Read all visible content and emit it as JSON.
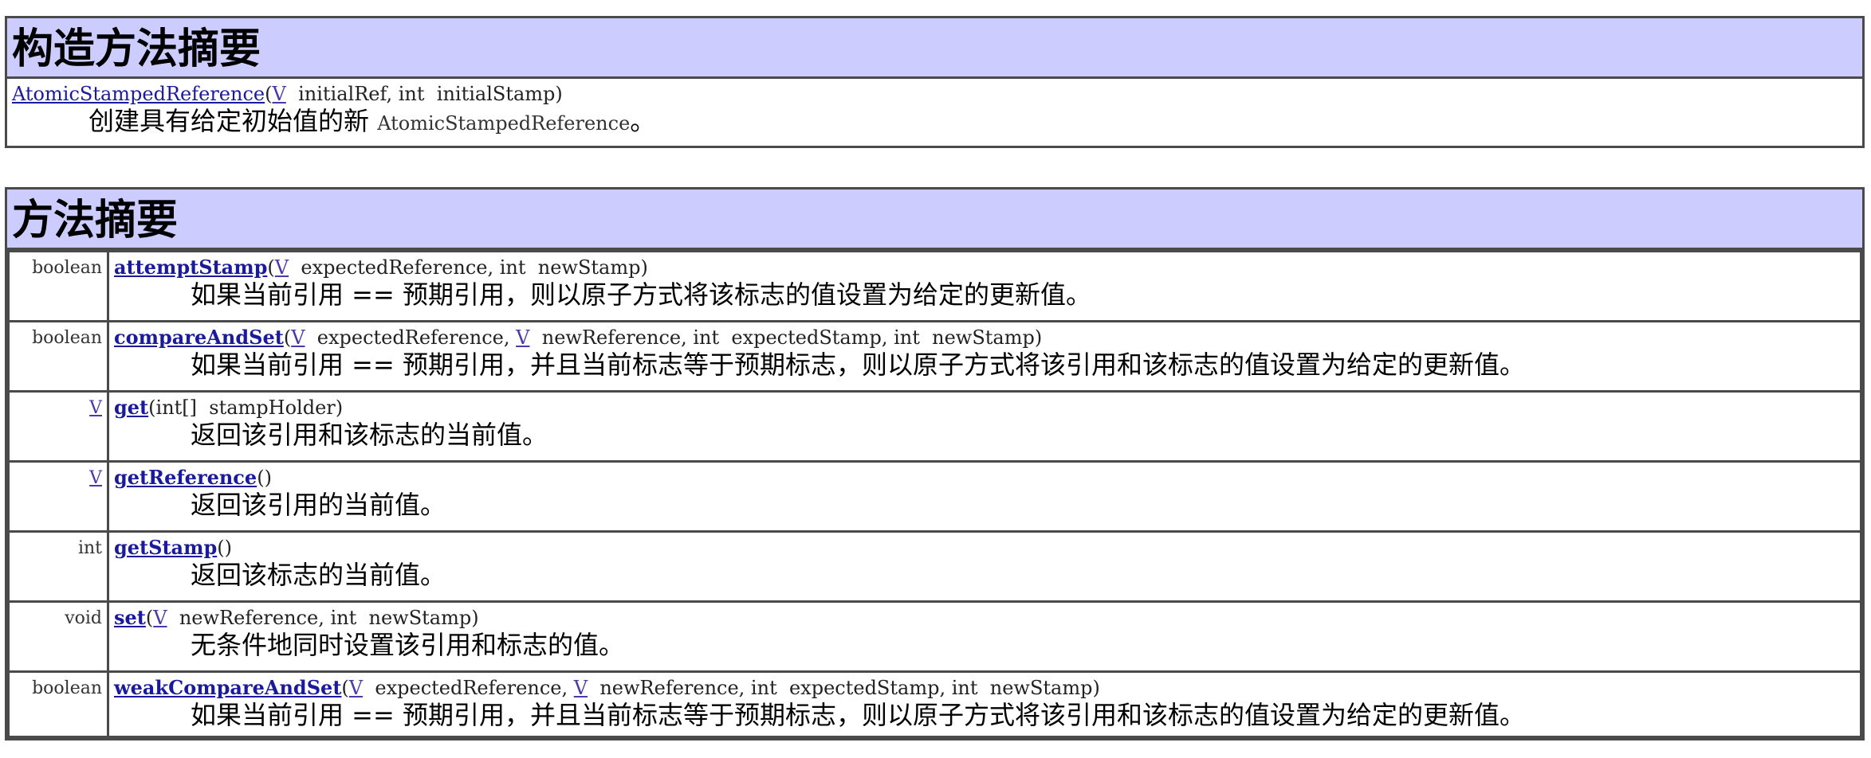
{
  "constructor_summary": {
    "title": "构造方法摘要",
    "rows": [
      {
        "name": "AtomicStampedReference",
        "sig_open": "(",
        "type1": "V",
        "p1": "  initialRef, int  initialStamp)",
        "desc_pre": "创建具有给定初始值的新 ",
        "desc_code": "AtomicStampedReference",
        "desc_post": "。"
      }
    ]
  },
  "method_summary": {
    "title": "方法摘要",
    "rows": [
      {
        "ret": "boolean",
        "name": "attemptStamp",
        "params": [
          {
            "t": "V",
            "link": true
          },
          {
            "t": "  expectedReference, int  newStamp)",
            "link": false
          }
        ],
        "desc": "如果当前引用 == 预期引用，则以原子方式将该标志的值设置为给定的更新值。"
      },
      {
        "ret": "boolean",
        "name": "compareAndSet",
        "params": [
          {
            "t": "V",
            "link": true
          },
          {
            "t": "  expectedReference, ",
            "link": false
          },
          {
            "t": "V",
            "link": true
          },
          {
            "t": "  newReference, int  expectedStamp, int  newStamp)",
            "link": false
          }
        ],
        "desc": "如果当前引用 == 预期引用，并且当前标志等于预期标志，则以原子方式将该引用和该标志的值设置为给定的更新值。"
      },
      {
        "ret": "V",
        "ret_link": true,
        "name": "get",
        "params": [
          {
            "t": "int[]  stampHolder)",
            "link": false
          }
        ],
        "desc": "返回该引用和该标志的当前值。"
      },
      {
        "ret": "V",
        "ret_link": true,
        "name": "getReference",
        "params": [
          {
            "t": ")",
            "link": false
          }
        ],
        "desc": "返回该引用的当前值。"
      },
      {
        "ret": "int",
        "name": "getStamp",
        "params": [
          {
            "t": ")",
            "link": false
          }
        ],
        "desc": "返回该标志的当前值。"
      },
      {
        "ret": "void",
        "name": "set",
        "params": [
          {
            "t": "V",
            "link": true
          },
          {
            "t": "  newReference, int  newStamp)",
            "link": false
          }
        ],
        "desc": "无条件地同时设置该引用和标志的值。"
      },
      {
        "ret": "boolean",
        "name": "weakCompareAndSet",
        "params": [
          {
            "t": "V",
            "link": true
          },
          {
            "t": "  expectedReference, ",
            "link": false
          },
          {
            "t": "V",
            "link": true
          },
          {
            "t": "  newReference, int  expectedStamp, int  newStamp)",
            "link": false
          }
        ],
        "desc": "如果当前引用 == 预期引用，并且当前标志等于预期标志，则以原子方式将该引用和该标志的值设置为给定的更新值。"
      }
    ]
  }
}
